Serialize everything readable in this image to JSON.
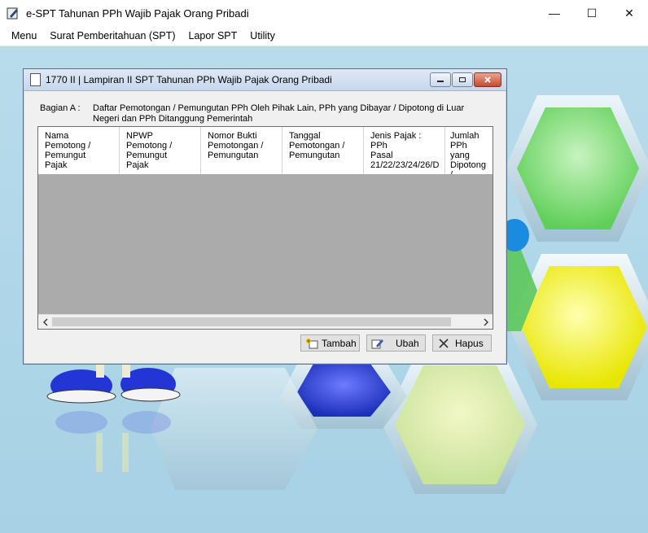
{
  "app": {
    "title": "e-SPT Tahunan PPh Wajib Pajak Orang Pribadi",
    "window_buttons": [
      "—",
      "☐",
      "✕"
    ]
  },
  "menu": {
    "items": [
      "Menu",
      "Surat Pemberitahuan (SPT)",
      "Lapor SPT",
      "Utility"
    ]
  },
  "dialog": {
    "title": "1770 II | Lampiran II SPT Tahunan  PPh Wajib Pajak Orang Pribadi",
    "bagian_label": "Bagian A :",
    "bagian_text": "Daftar Pemotongan / Pemungutan PPh Oleh Pihak Lain, PPh yang Dibayar / Dipotong di Luar Negeri dan PPh Ditanggung Pemerintah",
    "columns": [
      "Nama\nPemotong /\nPemungut\nPajak",
      "NPWP\nPemotong /\nPemungut\nPajak",
      "Nomor Bukti\nPemotongan /\nPemungutan",
      "Tanggal\nPemotongan /\nPemungutan",
      "Jenis Pajak : PPh\nPasal\n21/22/23/24/26/D",
      "Jumlah PPh\nyang\nDipotong /\nDipungut"
    ],
    "buttons": {
      "tambah": "Tambah",
      "ubah": "Ubah",
      "hapus": "Hapus"
    }
  },
  "colors": {
    "desktop_bg": "#b2d8ea",
    "dialog_bg": "#f0f0f0",
    "grid_empty": "#ababab"
  }
}
